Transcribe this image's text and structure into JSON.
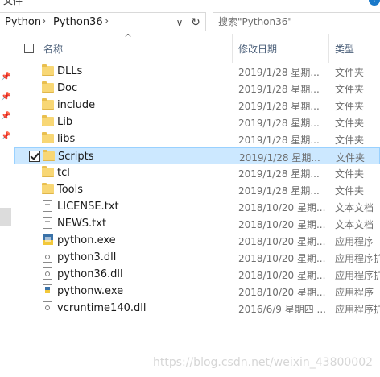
{
  "ribbon": {
    "partial_label": "文件",
    "help_glyph": "?"
  },
  "address_bar": {
    "breadcrumbs": [
      "Python",
      "Python36"
    ],
    "separator": "›",
    "dropdown_glyph": "∨",
    "refresh_glyph": "↻"
  },
  "search": {
    "placeholder": "搜索\"Python36\"",
    "value": ""
  },
  "columns": {
    "name": "名称",
    "modified": "修改日期",
    "type": "类型",
    "sort_glyph": "^"
  },
  "files": [
    {
      "name": "DLLs",
      "date": "2019/1/28 星期...",
      "type": "文件夹",
      "icon": "folder",
      "selected": false
    },
    {
      "name": "Doc",
      "date": "2019/1/28 星期...",
      "type": "文件夹",
      "icon": "folder",
      "selected": false
    },
    {
      "name": "include",
      "date": "2019/1/28 星期...",
      "type": "文件夹",
      "icon": "folder",
      "selected": false
    },
    {
      "name": "Lib",
      "date": "2019/1/28 星期...",
      "type": "文件夹",
      "icon": "folder",
      "selected": false
    },
    {
      "name": "libs",
      "date": "2019/1/28 星期...",
      "type": "文件夹",
      "icon": "folder",
      "selected": false
    },
    {
      "name": "Scripts",
      "date": "2019/1/28 星期...",
      "type": "文件夹",
      "icon": "folder",
      "selected": true
    },
    {
      "name": "tcl",
      "date": "2019/1/28 星期...",
      "type": "文件夹",
      "icon": "folder",
      "selected": false
    },
    {
      "name": "Tools",
      "date": "2019/1/28 星期...",
      "type": "文件夹",
      "icon": "folder",
      "selected": false
    },
    {
      "name": "LICENSE.txt",
      "date": "2018/10/20 星期...",
      "type": "文本文档",
      "icon": "text-document",
      "selected": false
    },
    {
      "name": "NEWS.txt",
      "date": "2018/10/20 星期...",
      "type": "文本文档",
      "icon": "text-document",
      "selected": false
    },
    {
      "name": "python.exe",
      "date": "2018/10/20 星期...",
      "type": "应用程序",
      "icon": "python-app",
      "selected": false
    },
    {
      "name": "python3.dll",
      "date": "2018/10/20 星期...",
      "type": "应用程序扩",
      "icon": "dll",
      "selected": false
    },
    {
      "name": "python36.dll",
      "date": "2018/10/20 星期...",
      "type": "应用程序扩",
      "icon": "dll",
      "selected": false
    },
    {
      "name": "pythonw.exe",
      "date": "2018/10/20 星期...",
      "type": "应用程序",
      "icon": "pythonw-app",
      "selected": false
    },
    {
      "name": "vcruntime140.dll",
      "date": "2016/6/9 星期四 ...",
      "type": "应用程序扩",
      "icon": "dll",
      "selected": false
    }
  ],
  "watermark": "https://blog.csdn.net/weixin_43800002",
  "colors": {
    "selection_fill": "#cce8ff",
    "selection_border": "#99d1ff",
    "folder": "#f8d775",
    "header_text": "#4c607a"
  }
}
